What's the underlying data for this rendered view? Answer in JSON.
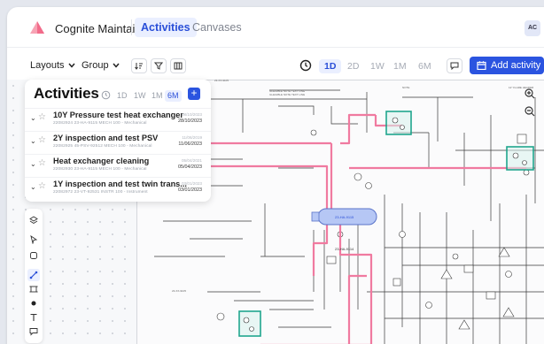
{
  "app": {
    "title": "Cognite Maintain",
    "tabs": [
      {
        "label": "Activities",
        "active": true
      },
      {
        "label": "Canvases",
        "active": false
      }
    ],
    "avatar": "AC",
    "brand_color": "#2b54e0",
    "logo_color": "#f26b8a"
  },
  "toolbar": {
    "layouts_label": "Layouts",
    "group_label": "Group",
    "icons": [
      "sort-icon",
      "filter-icon",
      "columns-icon"
    ],
    "ranges": [
      "1D",
      "2D",
      "1W",
      "1M",
      "6M"
    ],
    "active_range": "1D",
    "add_activity_label": "Add activity"
  },
  "panel": {
    "title": "Activities",
    "ranges": [
      "1D",
      "1W",
      "1M",
      "6M"
    ],
    "active_range": "6M",
    "items": [
      {
        "name": "10Y Pressure test heat exchanger",
        "meta": "22082924    23-HA-9115    MECH    100 - Mechanical",
        "date_top": "08/10/2023",
        "date_bottom": "28/10/2023"
      },
      {
        "name": "2Y inspection and test PSV",
        "meta": "22082925    45-PSV-92512    MECH    100 - Mechanical",
        "date_top": "11/06/2019",
        "date_bottom": "11/06/2023"
      },
      {
        "name": "Heat exchanger cleaning",
        "meta": "22082930    23-HA-9115    MECH    100 - Mechanical",
        "date_top": "05/04/2021",
        "date_bottom": "05/04/2023"
      },
      {
        "name": "1Y inspection and test twin trans...",
        "meta": "22082972    23-VT-92531    INSTR    100 - Instrument",
        "date_top": "03/01/2023",
        "date_bottom": "03/01/2023"
      }
    ]
  },
  "drawing": {
    "labels": [
      "23-HA-9115",
      "23-HA-9114",
      "23-XX-9105",
      "23-VT-92531",
      "23-XX-9105"
    ]
  }
}
